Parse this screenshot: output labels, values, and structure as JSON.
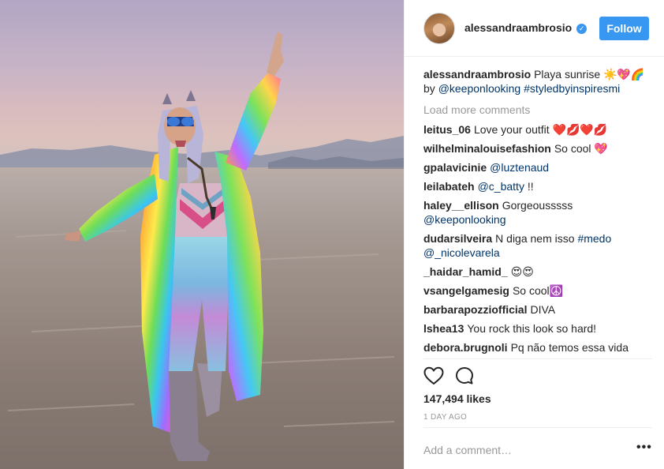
{
  "post": {
    "author": "alessandraambrosio",
    "follow_label": "Follow",
    "caption": {
      "text": "Playa sunrise ☀️💖🌈",
      "by_text": "by",
      "mention": "@keeponlooking",
      "hashtag": "#styledbyinspiresmi"
    },
    "load_more": "Load more comments",
    "comments": [
      {
        "user": "leitus_06",
        "parts": [
          {
            "t": "Love your outfit ❤️💋❤️💋",
            "link": false
          }
        ]
      },
      {
        "user": "wilhelminalouisefashion",
        "parts": [
          {
            "t": "So cool 💖",
            "link": false
          }
        ]
      },
      {
        "user": "gpalavicinie",
        "parts": [
          {
            "t": "@luztenaud",
            "link": true
          }
        ]
      },
      {
        "user": "leilabateh",
        "parts": [
          {
            "t": "@c_batty",
            "link": true
          },
          {
            "t": " !!",
            "link": false
          }
        ]
      },
      {
        "user": "haley__ellison",
        "parts": [
          {
            "t": "Gorgeousssss ",
            "link": false
          },
          {
            "t": "@keeponlooking",
            "link": true
          }
        ]
      },
      {
        "user": "dudarsilveira",
        "parts": [
          {
            "t": "N diga nem isso ",
            "link": false
          },
          {
            "t": "#medo",
            "link": true
          },
          {
            "t": " ",
            "link": false
          },
          {
            "t": "@_nicolevarela",
            "link": true
          }
        ]
      },
      {
        "user": "_haidar_hamid_",
        "parts": [
          {
            "t": "😍😍",
            "link": false
          }
        ]
      },
      {
        "user": "vsangelgamesig",
        "parts": [
          {
            "t": "So cool☮️",
            "link": false
          }
        ]
      },
      {
        "user": "barbarapozziofficial",
        "parts": [
          {
            "t": "DIVA",
            "link": false
          }
        ]
      },
      {
        "user": "lshea13",
        "parts": [
          {
            "t": "You rock this look so hard!",
            "link": false
          }
        ]
      },
      {
        "user": "debora.brugnoli",
        "parts": [
          {
            "t": "Pq não temos essa vida",
            "link": false
          }
        ]
      }
    ],
    "likes": "147,494 likes",
    "timestamp": "1 DAY AGO",
    "add_comment_placeholder": "Add a comment…",
    "more_options": "•••"
  },
  "icons": {
    "verified": "verified-badge-icon",
    "like": "heart-icon",
    "comment": "comment-bubble-icon",
    "more": "more-options-icon"
  },
  "colors": {
    "accent": "#3897f0",
    "link": "#003569",
    "muted": "#999999",
    "text": "#262626"
  }
}
